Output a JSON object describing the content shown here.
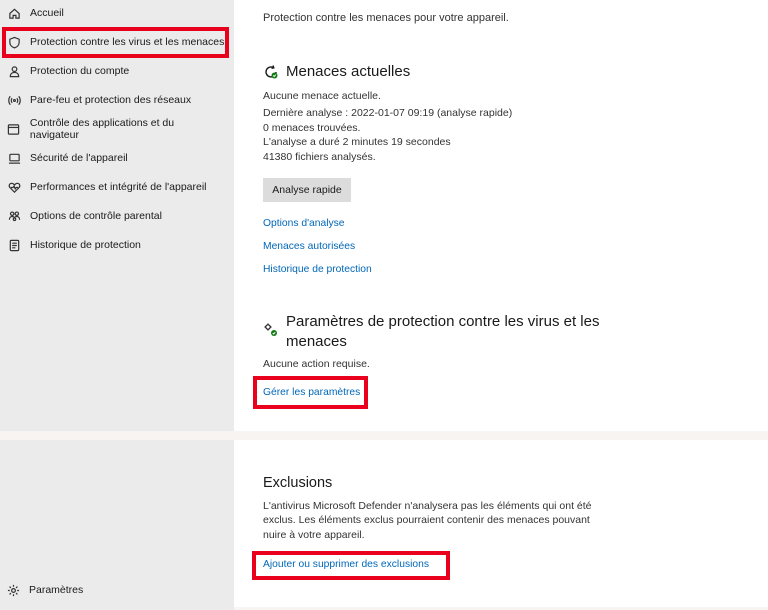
{
  "sidebar": {
    "items": [
      {
        "label": "Accueil",
        "icon": "home-icon"
      },
      {
        "label": "Protection contre les virus et les menaces",
        "icon": "shield-icon"
      },
      {
        "label": "Protection du compte",
        "icon": "person-icon"
      },
      {
        "label": "Pare-feu et protection des réseaux",
        "icon": "wifi-signal-icon"
      },
      {
        "label": "Contrôle des applications et du navigateur",
        "icon": "browser-window-icon"
      },
      {
        "label": "Sécurité de l'appareil",
        "icon": "laptop-icon"
      },
      {
        "label": "Performances et intégrité de l'appareil",
        "icon": "heart-pulse-icon"
      },
      {
        "label": "Options de contrôle parental",
        "icon": "family-icon"
      },
      {
        "label": "Historique de protection",
        "icon": "history-icon"
      }
    ],
    "settings_label": "Paramètres"
  },
  "main": {
    "subtitle": "Protection contre les menaces pour votre appareil.",
    "current_threats": {
      "title": "Menaces actuelles",
      "lines": [
        "Aucune menace actuelle.",
        "Dernière analyse : 2022-01-07 09:19 (analyse rapide)",
        "0 menaces trouvées.",
        "L'analyse a duré 2 minutes 19 secondes",
        "41380 fichiers analysés."
      ],
      "scan_button": "Analyse rapide",
      "links": [
        "Options d'analyse",
        "Menaces autorisées",
        "Historique de protection"
      ]
    },
    "protection_settings": {
      "title_line1": "Paramètres de protection contre les virus et les",
      "title_line2": "menaces",
      "status": "Aucune action requise.",
      "manage_link": "Gérer les paramètres"
    },
    "exclusions": {
      "title": "Exclusions",
      "lines": [
        "L'antivirus Microsoft Defender n'analysera pas les éléments qui ont été",
        "exclus. Les éléments exclus pourraient contenir des menaces pouvant",
        "nuire à votre appareil."
      ],
      "link": "Ajouter ou supprimer des exclusions"
    }
  },
  "colors": {
    "accent_link": "#0067b8",
    "highlight": "#e8001c",
    "sidebar_bg": "#ebebeb",
    "status_green": "#107c10"
  }
}
